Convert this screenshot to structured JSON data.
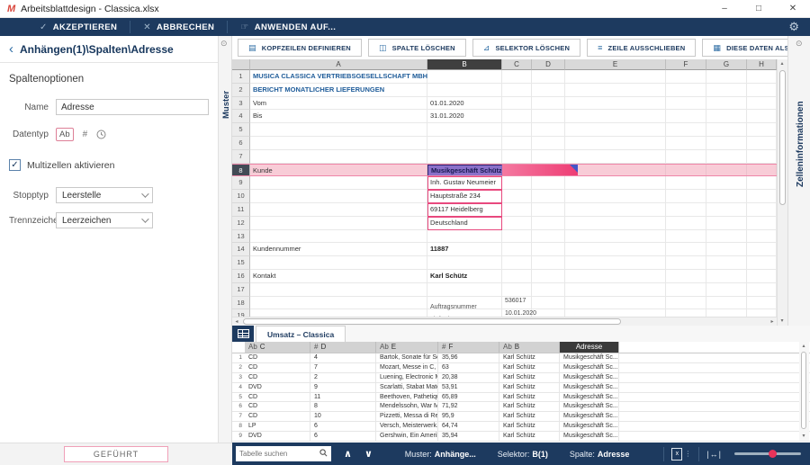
{
  "window": {
    "logo_letter": "M",
    "title": "Arbeitsblattdesign - Classica.xlsx",
    "minimize": "–",
    "maximize": "□",
    "close": "✕"
  },
  "toolbar": {
    "accept_icon": "✓",
    "accept": "AKZEPTIEREN",
    "cancel_icon": "✕",
    "cancel": "ABBRECHEN",
    "apply_icon": "☞",
    "apply": "ANWENDEN AUF...",
    "gear_icon": "⚙"
  },
  "panel": {
    "back_icon": "‹",
    "breadcrumb": "Anhängen(1)\\Spalten\\Adresse",
    "section_title": "Spaltenoptionen",
    "name_label": "Name",
    "name_value": "Adresse",
    "datatype_label": "Datentyp",
    "datatype_text": "Ab",
    "datatype_number": "#",
    "checkbox_glyph": "✓",
    "multicell_label": "Multizellen aktivieren",
    "stop_label": "Stopptyp",
    "stop_value": "Leerstelle",
    "delimiter_label": "Trennzeichen",
    "delimiter_value": "Leerzeichen",
    "guided_button": "GEFÜHRT"
  },
  "strips": {
    "left_tab": "Muster",
    "right_tab": "Zelleninformationen",
    "pin_icon": "⊙"
  },
  "actions": [
    {
      "label": "KOPFZEILEN DEFINIEREN",
      "icon": "define-headers-icon",
      "glyph": "▤"
    },
    {
      "label": "SPALTE LÖSCHEN",
      "icon": "delete-column-icon",
      "glyph": "◫"
    },
    {
      "label": "SELEKTOR LÖSCHEN",
      "icon": "delete-selector-icon",
      "glyph": "⊿"
    },
    {
      "label": "ZEILE AUSSCHLIEBEN",
      "icon": "exclude-row-icon",
      "glyph": "≡"
    },
    {
      "label": "DIESE DATEN ALS ANHANG ERFASSEN",
      "icon": "capture-append-icon",
      "glyph": "▦"
    }
  ],
  "spreadsheet": {
    "columns": [
      "A",
      "B",
      "C",
      "D",
      "E",
      "F",
      "G",
      "H"
    ],
    "selected_column": "B",
    "selected_row": 8,
    "row_count": 19,
    "cells": [
      {
        "r": 1,
        "c": "A",
        "t": "MUSICA CLASSICA VERTRIEBSGESELLSCHAFT MBH",
        "s": "heading"
      },
      {
        "r": 2,
        "c": "A",
        "t": "BERICHT MONATLICHER LIEFERUNGEN",
        "s": "heading"
      },
      {
        "r": 3,
        "c": "A",
        "t": "Vom"
      },
      {
        "r": 3,
        "c": "B",
        "t": "01.01.2020"
      },
      {
        "r": 4,
        "c": "A",
        "t": "Bis"
      },
      {
        "r": 4,
        "c": "B",
        "t": "31.01.2020"
      },
      {
        "r": 8,
        "c": "A",
        "t": "Kunde"
      },
      {
        "r": 8,
        "c": "B",
        "t": "Musikgeschäft Schütz",
        "s": "selected"
      },
      {
        "r": 9,
        "c": "B",
        "t": "Inh. Gustav Neumeier",
        "s": "capture"
      },
      {
        "r": 10,
        "c": "B",
        "t": "Hauptstraße 234",
        "s": "capture"
      },
      {
        "r": 11,
        "c": "B",
        "t": "69117 Heidelberg",
        "s": "capture"
      },
      {
        "r": 12,
        "c": "B",
        "t": "Deutschland",
        "s": "capture"
      },
      {
        "r": 14,
        "c": "A",
        "t": "Kundennummer"
      },
      {
        "r": 14,
        "c": "B",
        "t": "11887",
        "s": "bold"
      },
      {
        "r": 16,
        "c": "A",
        "t": "Kontakt"
      },
      {
        "r": 16,
        "c": "B",
        "t": "Karl Schütz",
        "s": "bold"
      },
      {
        "r": 18,
        "c": "B",
        "t": "Auftragsnummer",
        "s": "bottom"
      },
      {
        "r": 18,
        "c": "C",
        "t": "536017",
        "s": "top"
      },
      {
        "r": 19,
        "c": "B",
        "t": "Lieferdatum",
        "s": "bottom"
      },
      {
        "r": 19,
        "c": "C",
        "t": "10.01.2020",
        "s": "top"
      }
    ]
  },
  "sheet_tab": {
    "label": "Umsatz – Classica"
  },
  "preview_table": {
    "headers": [
      {
        "prefix": "Ab",
        "label": "C"
      },
      {
        "prefix": "#",
        "label": "D"
      },
      {
        "prefix": "Ab",
        "label": "E"
      },
      {
        "prefix": "#",
        "label": "F"
      },
      {
        "prefix": "Ab",
        "label": "B"
      },
      {
        "prefix": "",
        "label": "Adresse",
        "selected": true
      }
    ],
    "rows": [
      [
        "CD",
        "4",
        "Bartok, Sonate für So...",
        "35,96",
        "Karl Schütz",
        "Musikgeschäft Sc..."
      ],
      [
        "CD",
        "7",
        "Mozart, Messe in C, K...",
        "63",
        "Karl Schütz",
        "Musikgeschäft Sc..."
      ],
      [
        "CD",
        "2",
        "Luening, Electronic M...",
        "20,38",
        "Karl Schütz",
        "Musikgeschäft Sc..."
      ],
      [
        "DVD",
        "9",
        "Scarlatti, Stabat Mater",
        "53,91",
        "Karl Schütz",
        "Musikgeschäft Sc..."
      ],
      [
        "CD",
        "11",
        "Beethoven, Pathetiqu...",
        "65,89",
        "Karl Schütz",
        "Musikgeschäft Sc..."
      ],
      [
        "CD",
        "8",
        "Mendelssohn, War M...",
        "71,92",
        "Karl Schütz",
        "Musikgeschäft Sc..."
      ],
      [
        "CD",
        "10",
        "Pizzetti, Messa di Re...",
        "95,9",
        "Karl Schütz",
        "Musikgeschäft Sc..."
      ],
      [
        "LP",
        "6",
        "Versch, Meisterwerk...",
        "64,74",
        "Karl Schütz",
        "Musikgeschäft Sc..."
      ],
      [
        "DVD",
        "6",
        "Gershwin, Ein Amerik...",
        "35,94",
        "Karl Schütz",
        "Musikgeschäft Sc..."
      ]
    ]
  },
  "statusbar": {
    "search_placeholder": "Tabelle suchen",
    "prev_icon": "∧",
    "next_icon": "∨",
    "muster_label": "Muster:",
    "muster_value": "Anhänge...",
    "selektor_label": "Selektor:",
    "selektor_value": "B(1)",
    "spalte_label": "Spalte:",
    "spalte_value": "Adresse",
    "excel_icon_glyph": "x",
    "resize_icon": "|↔|"
  },
  "colors": {
    "navy": "#1d3a5f",
    "accent_blue": "#2e6da4",
    "row_highlight_pink": "#f8ccd7",
    "selection_magenta": "#ee3d74",
    "selected_cell_purple": "#8a70c9",
    "slider_dot_red": "#e8335a"
  }
}
